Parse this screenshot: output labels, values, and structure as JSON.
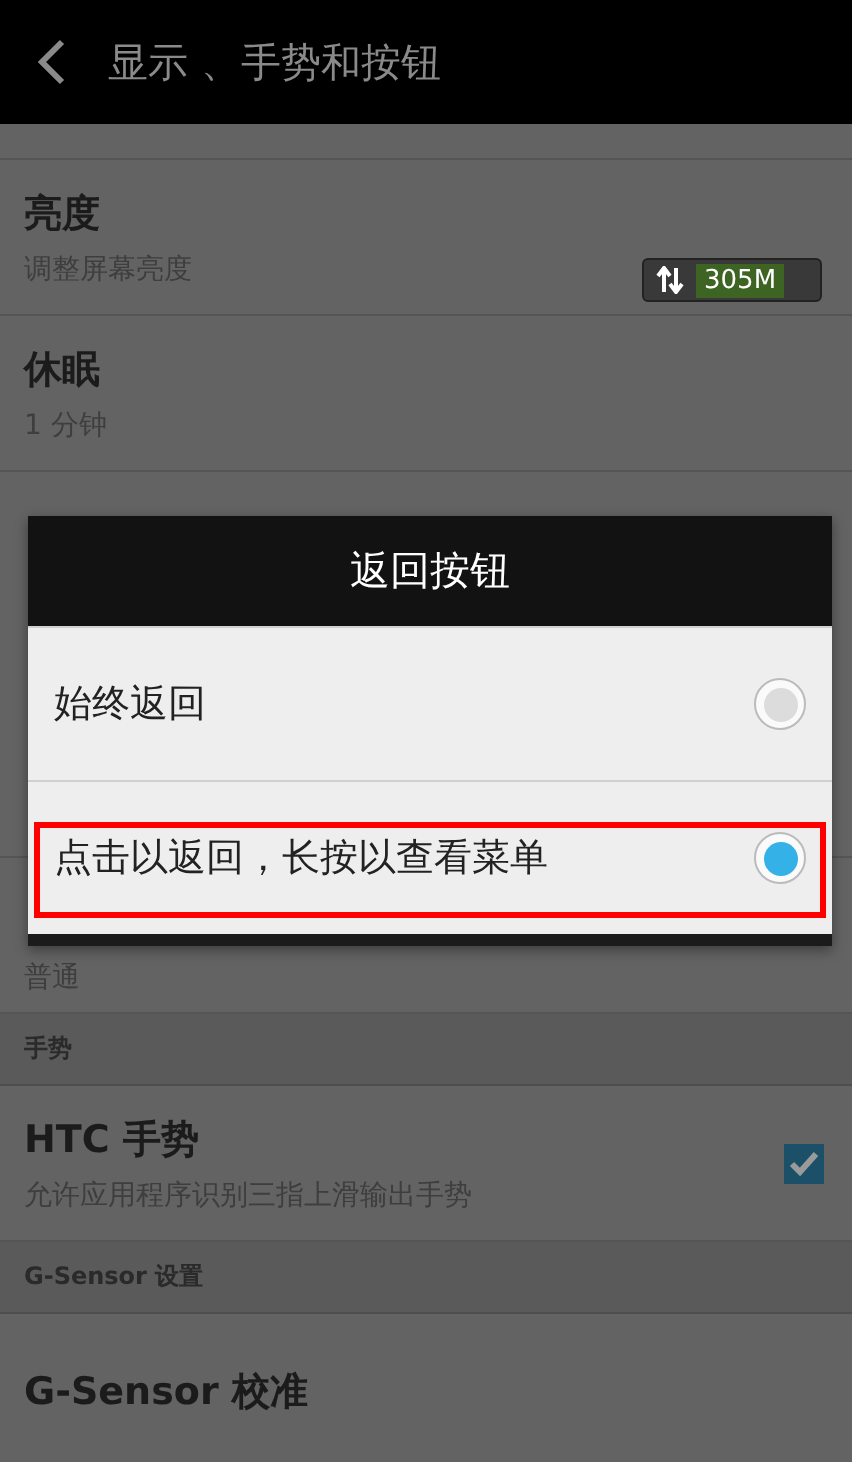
{
  "header": {
    "title": "显示 、手势和按钮"
  },
  "rows": [
    {
      "kind": "sliver"
    },
    {
      "kind": "item",
      "title": "亮度",
      "subtitle": "调整屏幕亮度"
    },
    {
      "kind": "item",
      "title": "休眠",
      "subtitle": "1 分钟"
    },
    {
      "kind": "hidden"
    },
    {
      "kind": "item",
      "subtitle": "普通"
    },
    {
      "kind": "section",
      "title": "手势"
    },
    {
      "kind": "check",
      "title": "HTC 手势",
      "subtitle": "允许应用程序识别三指上滑输出手势",
      "checked": true
    },
    {
      "kind": "section",
      "title": "G-Sensor 设置"
    },
    {
      "kind": "item",
      "title": "G-Sensor 校准"
    }
  ],
  "data_monitor": {
    "reading": "305M"
  },
  "dialog": {
    "title": "返回按钮",
    "options": [
      {
        "label": "始终返回",
        "selected": false,
        "highlighted": false
      },
      {
        "label": "点击以返回，长按以查看菜单",
        "selected": true,
        "highlighted": true
      }
    ]
  }
}
